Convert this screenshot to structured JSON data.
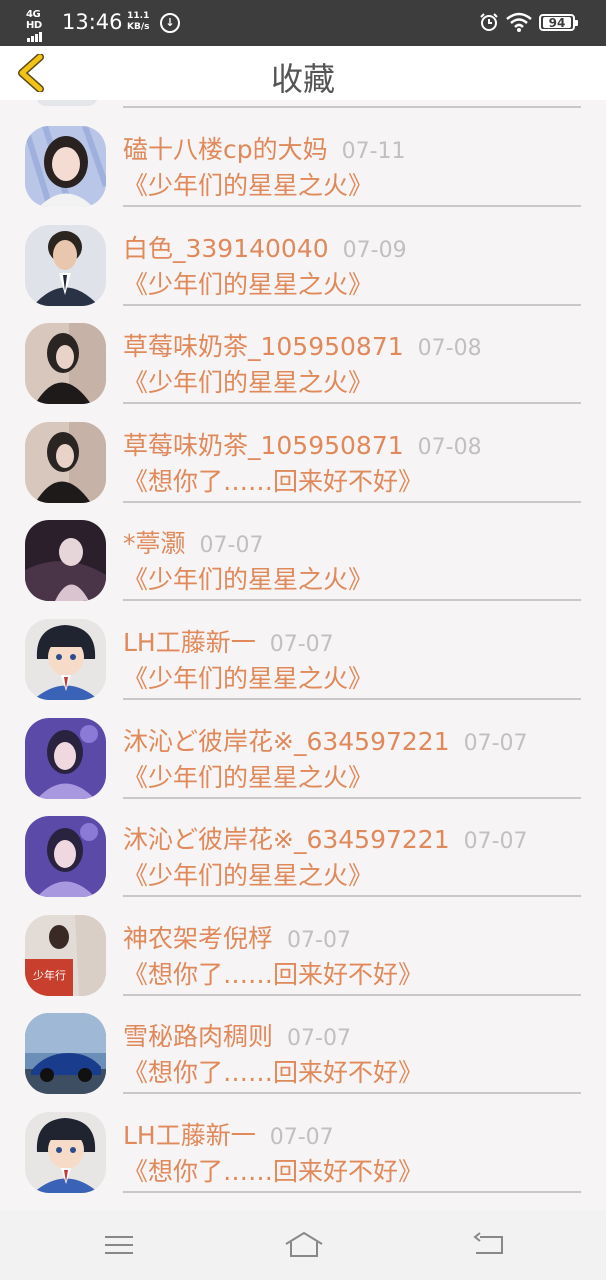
{
  "status_bar": {
    "network": "4G HD",
    "time": "13:46",
    "speed_value": "11.1",
    "speed_unit": "KB/s",
    "battery": "94"
  },
  "header": {
    "title": "收藏"
  },
  "colors": {
    "accent": "#e0895a",
    "back_arrow": "#f2c316",
    "date": "#c0c0c0"
  },
  "items": [
    {
      "name": "磕十八楼cp的大妈",
      "date": "07-11",
      "work": "《少年们的星星之火》",
      "avatar": "girl-portrait"
    },
    {
      "name": "白色_339140040",
      "date": "07-09",
      "work": "《少年们的星星之火》",
      "avatar": "boy-in-suit"
    },
    {
      "name": "草莓味奶茶_105950871",
      "date": "07-08",
      "work": "《少年们的星星之火》",
      "avatar": "girl-by-window"
    },
    {
      "name": "草莓味奶茶_105950871",
      "date": "07-08",
      "work": "《想你了……回来好不好》",
      "avatar": "girl-by-window"
    },
    {
      "name": "*葶灏",
      "date": "07-07",
      "work": "《少年们的星星之火》",
      "avatar": "dark-photo"
    },
    {
      "name": "LH工藤新一",
      "date": "07-07",
      "work": "《少年们的星星之火》",
      "avatar": "anime-boy"
    },
    {
      "name": "沐沁ど彼岸花※_634597221",
      "date": "07-07",
      "work": "《少年们的星星之火》",
      "avatar": "purple-girl"
    },
    {
      "name": "沐沁ど彼岸花※_634597221",
      "date": "07-07",
      "work": "《少年们的星星之火》",
      "avatar": "purple-girl"
    },
    {
      "name": "神农架考倪桴",
      "date": "07-07",
      "work": "《想你了……回来好不好》",
      "avatar": "red-photo"
    },
    {
      "name": "雪秘路肉稠则",
      "date": "07-07",
      "work": "《想你了……回来好不好》",
      "avatar": "blue-car"
    },
    {
      "name": "LH工藤新一",
      "date": "07-07",
      "work": "《想你了……回来好不好》",
      "avatar": "anime-boy"
    }
  ]
}
